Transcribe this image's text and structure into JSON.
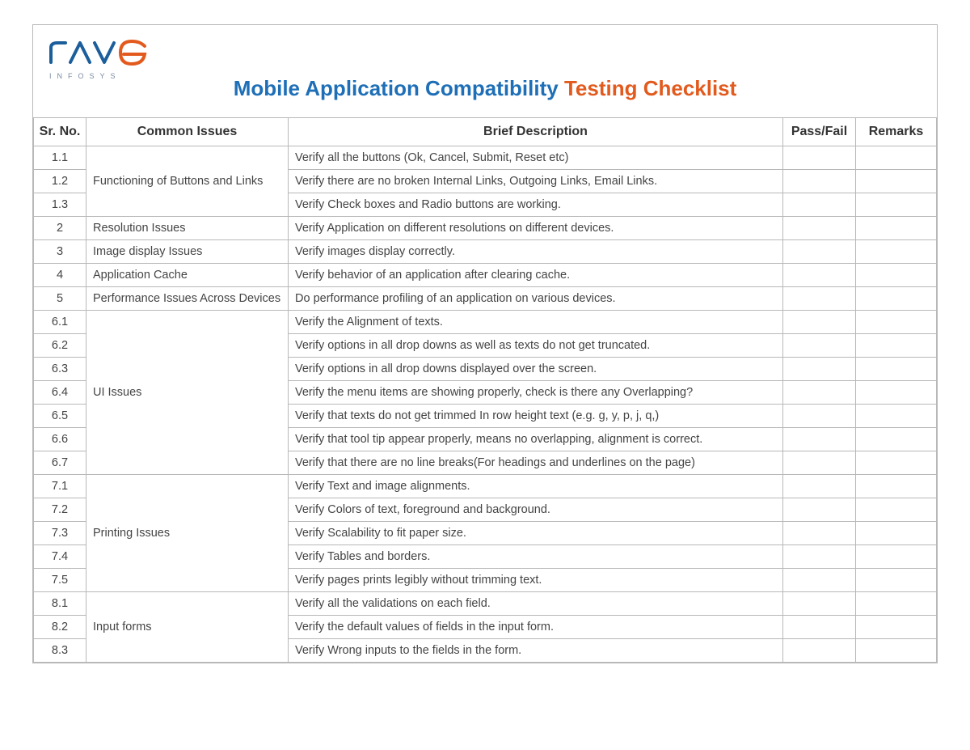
{
  "logo": {
    "main": "rave",
    "sub": "INFOSYS"
  },
  "title": {
    "blue": "Mobile Application Compatibility ",
    "orange": "Testing Checklist"
  },
  "columns": {
    "sr": "Sr. No.",
    "issue": "Common Issues",
    "desc": "Brief Description",
    "pass": "Pass/Fail",
    "remarks": "Remarks"
  },
  "groups": [
    {
      "issue": "Functioning of Buttons and Links",
      "rows": [
        {
          "sr": "1.1",
          "desc": "Verify all the buttons (Ok, Cancel, Submit, Reset etc)",
          "pass": "",
          "remarks": ""
        },
        {
          "sr": "1.2",
          "desc": "Verify there are no broken Internal Links, Outgoing Links, Email Links.",
          "pass": "",
          "remarks": ""
        },
        {
          "sr": "1.3",
          "desc": "Verify Check boxes and Radio buttons are working.",
          "pass": "",
          "remarks": ""
        }
      ]
    },
    {
      "issue": "Resolution Issues",
      "rows": [
        {
          "sr": "2",
          "desc": "Verify Application on different resolutions on different devices.",
          "pass": "",
          "remarks": ""
        }
      ]
    },
    {
      "issue": "Image display Issues",
      "rows": [
        {
          "sr": "3",
          "desc": "Verify images display correctly.",
          "pass": "",
          "remarks": ""
        }
      ]
    },
    {
      "issue": "Application Cache",
      "rows": [
        {
          "sr": "4",
          "desc": "Verify behavior of an application after clearing cache.",
          "pass": "",
          "remarks": ""
        }
      ]
    },
    {
      "issue": "Performance Issues Across Devices",
      "rows": [
        {
          "sr": "5",
          "desc": "Do performance profiling of an application on various devices.",
          "pass": "",
          "remarks": ""
        }
      ]
    },
    {
      "issue": "UI Issues",
      "rows": [
        {
          "sr": "6.1",
          "desc": "Verify the Alignment of texts.",
          "pass": "",
          "remarks": ""
        },
        {
          "sr": "6.2",
          "desc": "Verify options in all drop downs as well as texts do not get truncated.",
          "pass": "",
          "remarks": ""
        },
        {
          "sr": "6.3",
          "desc": "Verify options in all drop downs displayed over the screen.",
          "pass": "",
          "remarks": ""
        },
        {
          "sr": "6.4",
          "desc": "Verify the menu items are showing properly, check is there any Overlapping?",
          "pass": "",
          "remarks": ""
        },
        {
          "sr": "6.5",
          "desc": "Verify that texts do not get trimmed In row height text (e.g. g, y, p, j, q,)",
          "pass": "",
          "remarks": ""
        },
        {
          "sr": "6.6",
          "desc": "Verify that tool tip appear properly, means no overlapping, alignment is correct.",
          "pass": "",
          "remarks": ""
        },
        {
          "sr": "6.7",
          "desc": "Verify that there are no line breaks(For headings and underlines on the page)",
          "pass": "",
          "remarks": ""
        }
      ]
    },
    {
      "issue": "Printing Issues",
      "rows": [
        {
          "sr": "7.1",
          "desc": "Verify Text and image alignments.",
          "pass": "",
          "remarks": ""
        },
        {
          "sr": "7.2",
          "desc": "Verify Colors of text, foreground and background.",
          "pass": "",
          "remarks": ""
        },
        {
          "sr": "7.3",
          "desc": "Verify Scalability to fit paper size.",
          "pass": "",
          "remarks": ""
        },
        {
          "sr": "7.4",
          "desc": "Verify Tables and borders.",
          "pass": "",
          "remarks": ""
        },
        {
          "sr": "7.5",
          "desc": "Verify pages prints legibly without trimming text.",
          "pass": "",
          "remarks": ""
        }
      ]
    },
    {
      "issue": "Input forms",
      "rows": [
        {
          "sr": "8.1",
          "desc": "Verify all the validations on each field.",
          "pass": "",
          "remarks": ""
        },
        {
          "sr": "8.2",
          "desc": "Verify the default values of fields in the input form.",
          "pass": "",
          "remarks": ""
        },
        {
          "sr": "8.3",
          "desc": "Verify Wrong inputs to the fields in the form.",
          "pass": "",
          "remarks": ""
        }
      ]
    }
  ]
}
